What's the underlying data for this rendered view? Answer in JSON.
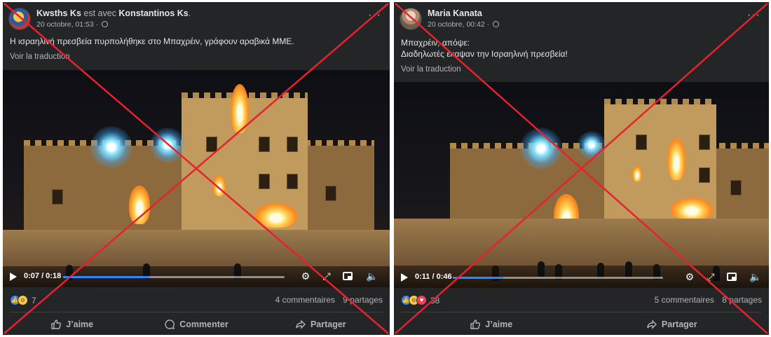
{
  "posts": [
    {
      "author": "Kwsths Ks",
      "with_text": " est avec ",
      "tagged": "Konstantinos Ks",
      "tagged_suffix": ".",
      "date": "20 octobre, 01:53 ·",
      "more": "···",
      "text_lines": [
        "Η ισραηλινή πρεσβεία πυρπολήθηκε στο Μπαχρέιν, γράφουν αραβικά ΜΜΕ."
      ],
      "translate": "Voir la traduction",
      "video": {
        "time": "0:07 / 0:18",
        "progress": 0.39
      },
      "reactions": [
        "like",
        "wow"
      ],
      "reaction_count": "7",
      "comments": "4 commentaires",
      "shares": "9 partages",
      "actions": [
        "J’aime",
        "Commenter",
        "Partager"
      ],
      "crossed_out": true
    },
    {
      "author": "Maria Kanata",
      "with_text": "",
      "tagged": "",
      "tagged_suffix": "",
      "date": "20 octobre, 00:42 ·",
      "more": "···",
      "text_lines": [
        "Μπαχρέιν, απόψε:",
        "Διαδηλωτές έκαψαν την Ισραηλινή πρεσβεία!"
      ],
      "translate": "Voir la traduction",
      "video": {
        "time": "0:11 / 0:46",
        "progress": 0.24
      },
      "reactions": [
        "like",
        "wow",
        "love"
      ],
      "reaction_count": "38",
      "comments": "5 commentaires",
      "shares": "8 partages",
      "actions": [
        "J’aime",
        "Partager"
      ],
      "crossed_out": true
    }
  ],
  "colors": {
    "card_bg": "#242526",
    "text_primary": "#e4e6eb",
    "text_secondary": "#b0b3b8",
    "progress_accent": "#2d88ff",
    "cross": "#e8212e"
  },
  "icons": [
    "globe-icon",
    "more-icon",
    "play-icon",
    "settings-icon",
    "expand-icon",
    "pip-icon",
    "volume-icon",
    "like-icon",
    "comment-icon",
    "share-icon",
    "cross-out-mark"
  ]
}
